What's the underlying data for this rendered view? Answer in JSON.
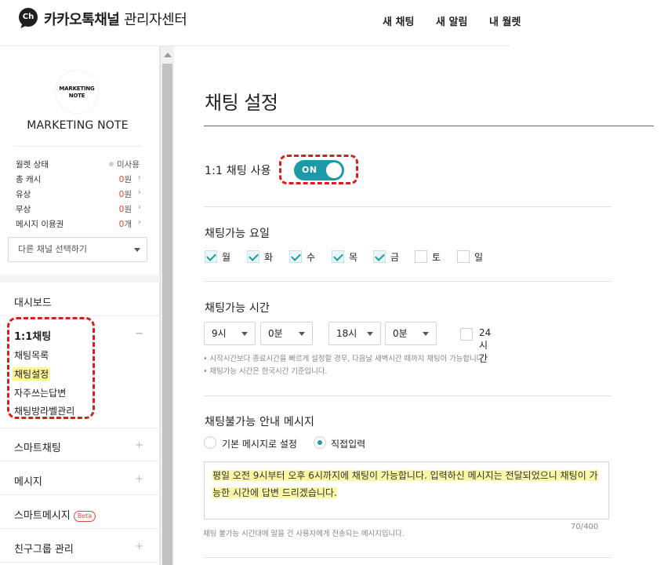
{
  "header": {
    "logo_badge": "Ch",
    "brand": "카카오톡채널",
    "subtitle": "관리자센터",
    "nav": [
      "새 채팅",
      "새 알림",
      "내 월렛"
    ]
  },
  "sidebar": {
    "profile_logo_line1": "MARKETING",
    "profile_logo_line2": "NOTE",
    "profile_name": "MARKETING NOTE",
    "stats": [
      {
        "label": "월렛 상태",
        "value": "미사용",
        "num": "",
        "unit": ""
      },
      {
        "label": "총 캐시",
        "num": "0",
        "unit": "원"
      },
      {
        "label": "유상",
        "num": "0",
        "unit": "원"
      },
      {
        "label": "무상",
        "num": "0",
        "unit": "원"
      },
      {
        "label": "메시지 이용권",
        "num": "0",
        "unit": "개"
      }
    ],
    "channel_select_placeholder": "다른 채널 선택하기",
    "menu": {
      "dashboard": "대시보드",
      "chat": "1:1채팅",
      "chat_sub": [
        "채팅목록",
        "채팅설정",
        "자주쓰는답변",
        "채팅방라벨관리"
      ],
      "smart_chat": "스마트채팅",
      "message": "메시지",
      "smart_message": "스마트메시지",
      "beta": "Beta",
      "friend_group": "친구그룹 관리",
      "plus": "+",
      "minus": "−"
    }
  },
  "main": {
    "title": "채팅 설정",
    "chat_use_label": "1:1 채팅 사용",
    "toggle_label": "ON",
    "toggle_on": true,
    "days_label": "채팅가능 요일",
    "days": [
      {
        "label": "월",
        "checked": true
      },
      {
        "label": "화",
        "checked": true
      },
      {
        "label": "수",
        "checked": true
      },
      {
        "label": "목",
        "checked": true
      },
      {
        "label": "금",
        "checked": true
      },
      {
        "label": "토",
        "checked": false
      },
      {
        "label": "일",
        "checked": false
      }
    ],
    "hours_label": "채팅가능 시간",
    "start_hour": "9시",
    "start_min": "0분",
    "end_hour": "18시",
    "end_min": "0분",
    "all_day_label": "24시간",
    "notes": [
      "• 시작시간보다 종료시간을 빠르게 설정할 경우, 다음날 새벽시간 때까지 채팅이 가능합니다.",
      "• 채팅가능 시간은 한국시간 기준입니다."
    ],
    "unavailable_label": "채팅불가능 안내 메시지",
    "radio_default": "기본 메시지로 설정",
    "radio_direct": "직접입력",
    "message_text": "평일 오전 9시부터 오후 6시까지에 채팅이 가능합니다. 입력하신 메시지는 전달되었으니 채팅이 가능한 시간에 답변 드리겠습니다.",
    "message_hint": "채팅 불가능 시간대에 말을 건 사용자에게 전송되는 메시지입니다.",
    "counter": "70/400"
  }
}
